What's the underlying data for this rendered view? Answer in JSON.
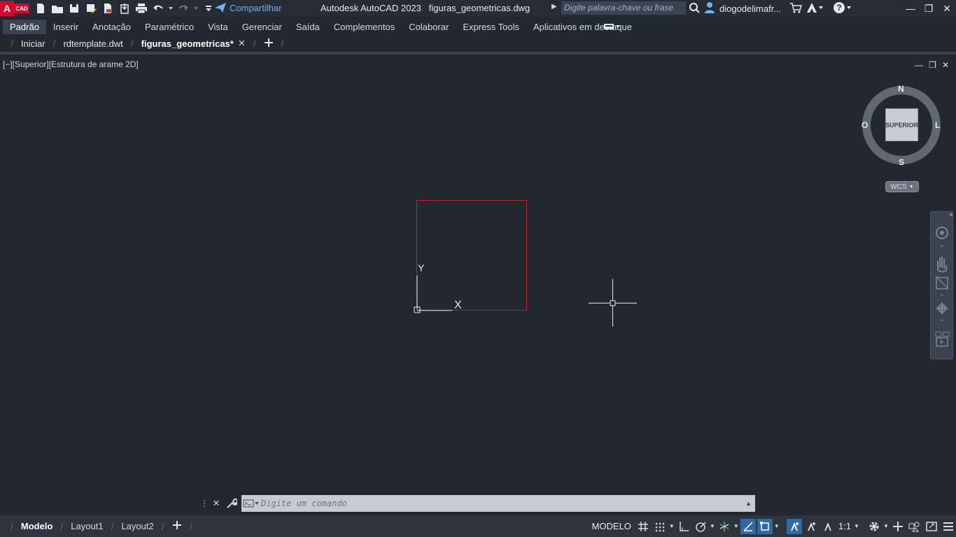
{
  "app": {
    "logo_main": "A",
    "logo_sub": "CAD",
    "title": "Autodesk AutoCAD 2023   figuras_geometricas.dwg",
    "share_label": "Compartilhar",
    "search_placeholder": "Digite palavra-chave ou frase",
    "username": "diogodelimafr..."
  },
  "ribbon": {
    "tabs": [
      "Padrão",
      "Inserir",
      "Anotação",
      "Paramétrico",
      "Vista",
      "Gerenciar",
      "Saída",
      "Complementos",
      "Colaborar",
      "Express Tools",
      "Aplicativos em destaque"
    ]
  },
  "doc_tabs": [
    {
      "label": "Iniciar"
    },
    {
      "label": "rdtemplate.dwt"
    },
    {
      "label": "figuras_geometricas*"
    }
  ],
  "viewport": {
    "label": "[−][Superior][Estrutura de arame 2D]",
    "ucs_x": "X",
    "ucs_y": "Y"
  },
  "viewcube": {
    "face": "SUPERIOR",
    "north": "N",
    "south": "S",
    "east": "L",
    "west": "O",
    "wcs": "WCS"
  },
  "command": {
    "placeholder": "Digite um comando"
  },
  "status": {
    "layout_tabs": [
      "Modelo",
      "Layout1",
      "Layout2"
    ],
    "model_label": "MODELO",
    "scale": "1:1"
  },
  "colors": {
    "background": "#212830",
    "drawing_square": "#c8202b",
    "accent": "#2f6aa5"
  }
}
